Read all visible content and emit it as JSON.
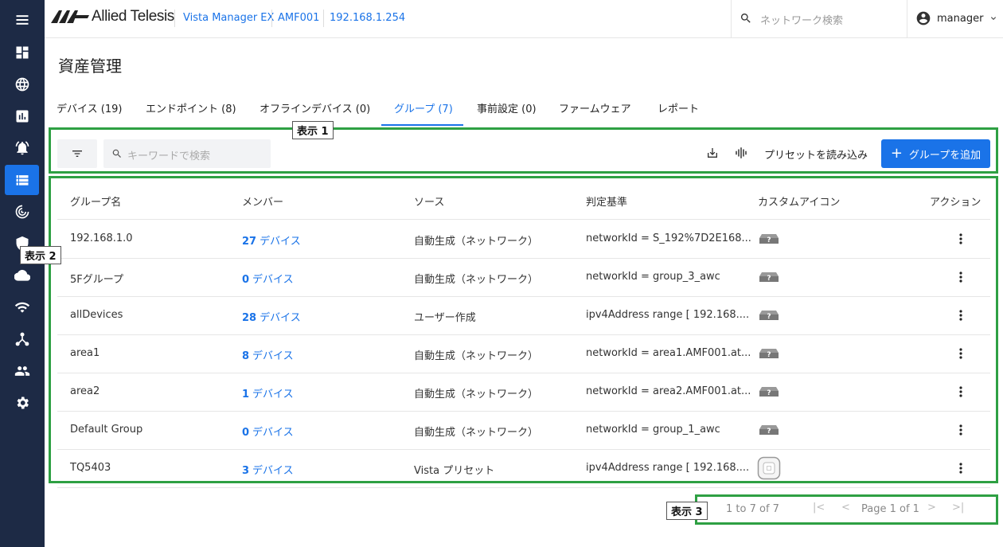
{
  "app": {
    "brand": "Allied Telesis",
    "breadcrumb": [
      "Vista Manager EX",
      "AMF001",
      "192.168.1.254"
    ],
    "search_placeholder": "ネットワーク検索",
    "user": "manager"
  },
  "sidebar": {
    "items": [
      {
        "icon": "menu-icon"
      },
      {
        "icon": "dashboard-icon"
      },
      {
        "icon": "globe-icon"
      },
      {
        "icon": "chart-icon"
      },
      {
        "icon": "alarm-icon"
      },
      {
        "icon": "asset-list-icon",
        "active": true
      },
      {
        "icon": "radar-icon"
      },
      {
        "icon": "security-shield-icon"
      },
      {
        "icon": "cloud-icon"
      },
      {
        "icon": "wifi-icon"
      },
      {
        "icon": "topology-icon"
      },
      {
        "icon": "users-icon"
      },
      {
        "icon": "settings-gear-icon"
      }
    ]
  },
  "page": {
    "title": "資産管理",
    "tabs": [
      {
        "label": "デバイス (19)"
      },
      {
        "label": "エンドポイント (8)"
      },
      {
        "label": "オフラインデバイス (0)"
      },
      {
        "label": "グループ (7)",
        "active": true
      },
      {
        "label": "事前設定 (0)"
      },
      {
        "label": "ファームウェア"
      },
      {
        "label": "レポート"
      }
    ]
  },
  "toolbar": {
    "search_placeholder": "キーワードで検索",
    "preset_label": "プリセットを読み込み",
    "add_label": "グループを追加"
  },
  "annotations": {
    "label1": "表示 1",
    "label2": "表示 2",
    "label3": "表示 3"
  },
  "table": {
    "columns": [
      "グループ名",
      "メンバー",
      "ソース",
      "判定基準",
      "カスタムアイコン",
      "アクション"
    ],
    "rows": [
      {
        "name": "192.168.1.0",
        "count": "27",
        "unit": "デバイス",
        "source": "自動生成（ネットワーク）",
        "criteria": "networkId = S_192%7D2E168...",
        "icon": "question-icon"
      },
      {
        "name": "5Fグループ",
        "count": "0",
        "unit": "デバイス",
        "source": "自動生成（ネットワーク）",
        "criteria": "networkId = group_3_awc",
        "icon": "question-icon"
      },
      {
        "name": "allDevices",
        "count": "28",
        "unit": "デバイス",
        "source": "ユーザー作成",
        "criteria": "ipv4Address range [ 192.168....",
        "icon": "question-icon"
      },
      {
        "name": "area1",
        "count": "8",
        "unit": "デバイス",
        "source": "自動生成（ネットワーク）",
        "criteria": "networkId = area1.AMF001.at...",
        "icon": "question-icon"
      },
      {
        "name": "area2",
        "count": "1",
        "unit": "デバイス",
        "source": "自動生成（ネットワーク）",
        "criteria": "networkId = area2.AMF001.at...",
        "icon": "question-icon"
      },
      {
        "name": "Default Group",
        "count": "0",
        "unit": "デバイス",
        "source": "自動生成（ネットワーク）",
        "criteria": "networkId = group_1_awc",
        "icon": "question-icon"
      },
      {
        "name": "TQ5403",
        "count": "3",
        "unit": "デバイス",
        "source": "Vista プリセット",
        "criteria": "ipv4Address range [ 192.168....",
        "icon": "access-point-icon"
      }
    ]
  },
  "pager": {
    "range": "1 to 7 of 7",
    "page": "Page 1 of 1"
  },
  "colors": {
    "sidebar": "#1d2a45",
    "accent": "#1a73e8",
    "highlight": "#2ea043"
  }
}
